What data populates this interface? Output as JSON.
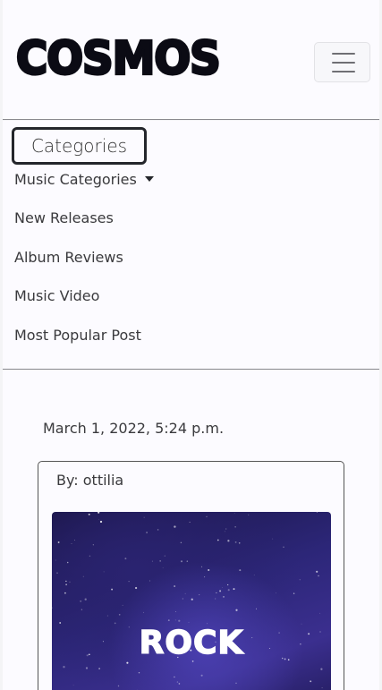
{
  "brand": {
    "name": "COSMOS"
  },
  "nav": {
    "toggler_icon": "hamburger-icon"
  },
  "categories": {
    "heading": "Categories",
    "dropdown_label": "Music Categories",
    "dropdown_icon": "caret-down-icon",
    "links": [
      "New Releases",
      "Album Reviews",
      "Music Video",
      "Most Popular Post"
    ]
  },
  "post": {
    "timestamp": "March 1, 2022, 5:24 p.m.",
    "author": "By: ottilia",
    "image_label": "ROCK"
  },
  "colors": {
    "background": "#fcfbff",
    "brand_text": "#0b0b14",
    "divider": "#8a8a8f",
    "heading_border": "#24262b",
    "image_sky": "#2c2678"
  }
}
